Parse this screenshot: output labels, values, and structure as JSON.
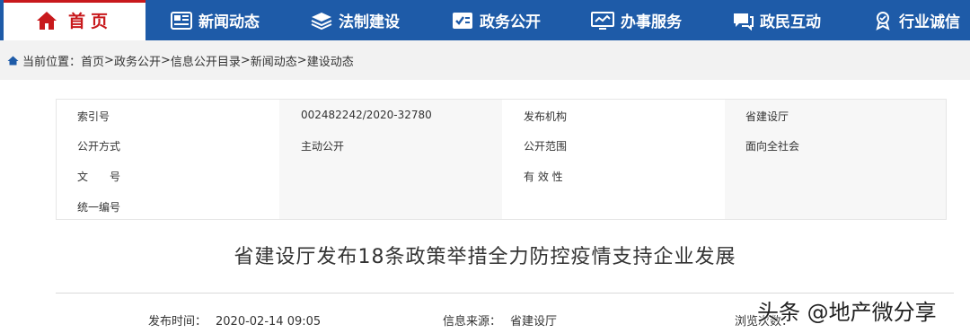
{
  "nav": {
    "home": "首页",
    "items": [
      {
        "label": "新闻动态",
        "icon": "newspaper-icon"
      },
      {
        "label": "法制建设",
        "icon": "layers-icon"
      },
      {
        "label": "政务公开",
        "icon": "id-card-icon"
      },
      {
        "label": "办事服务",
        "icon": "monitor-icon"
      },
      {
        "label": "政民互动",
        "icon": "chat-icon"
      },
      {
        "label": "行业诚信",
        "icon": "badge-icon"
      }
    ]
  },
  "breadcrumb": {
    "prefix": "当前位置：",
    "items": [
      "首页",
      "政务公开",
      "信息公开目录",
      "新闻动态",
      "建设动态"
    ],
    "separator": ">"
  },
  "info": {
    "index_label": "索引号",
    "index_value": "002482242/2020-32780",
    "publisher_label": "发布机构",
    "publisher_value": "省建设厅",
    "open_mode_label": "公开方式",
    "open_mode_value": "主动公开",
    "open_scope_label": "公开范围",
    "open_scope_value": "面向全社会",
    "doc_no_label": "文　　号",
    "validity_label": "有 效 性",
    "serial_label": "统一编号"
  },
  "article": {
    "title": "省建设厅发布18条政策举措全力防控疫情支持企业发展",
    "time_label": "发布时间：",
    "time_value": "2020-02-14 09:05",
    "source_label": "信息来源：",
    "source_value": "省建设厅",
    "views_label": "浏览次数："
  },
  "watermark": "头条 @地产微分享",
  "colors": {
    "nav_bg": "#1e5ba8",
    "accent_red": "#c8191c",
    "crumb_bg": "#f2f2f2"
  }
}
